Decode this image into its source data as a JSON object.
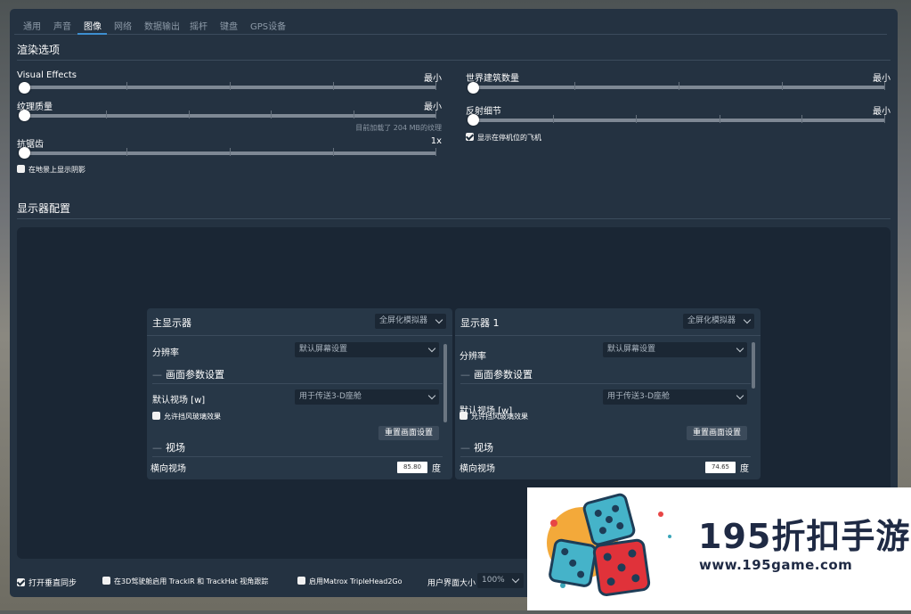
{
  "tabs": [
    "通用",
    "声音",
    "图像",
    "网络",
    "数据输出",
    "摇杆",
    "键盘",
    "GPS设备"
  ],
  "active_tab_index": 2,
  "render": {
    "title": "渲染选项",
    "visual_effects": {
      "label": "Visual Effects",
      "value": "最小"
    },
    "texture_quality": {
      "label": "纹理质量",
      "value": "最小",
      "hint": "目前加载了 204 MB的纹理"
    },
    "antialiasing": {
      "label": "抗锯齿",
      "value": "1x"
    },
    "ground_shadows": {
      "label": "在地景上显示阴影",
      "checked": false
    },
    "world_objects": {
      "label": "世界建筑数量",
      "value": "最小"
    },
    "reflection_detail": {
      "label": "反射细节",
      "value": "最小"
    },
    "parked_aircraft": {
      "label": "显示在停机位的飞机",
      "checked": true
    }
  },
  "display": {
    "title": "显示器配置",
    "monitors": [
      {
        "title": "主显示器",
        "mode": "全屏化模拟器",
        "resolution_label": "分辨率",
        "resolution_value": "默认屏幕设置",
        "param_section": "画面参数设置",
        "fov_default_label": "默认视场 [w]",
        "fov_default_value": "用于传送3-D座舱",
        "windshield_label": "允许挡风玻璃效果",
        "windshield_checked": false,
        "reset_label": "重置画面设置",
        "fov_section": "视场",
        "hfov_label": "横向视场",
        "hfov_value": "85.80",
        "hfov_unit": "度"
      },
      {
        "title": "显示器 1",
        "mode": "全屏化模拟器",
        "resolution_label": "分辨率",
        "resolution_value": "默认屏幕设置",
        "param_section": "画面参数设置",
        "fov_default_label": "默认视场 [w]",
        "fov_default_value": "用于传送3-D座舱",
        "windshield_label": "允许挡风玻璃效果",
        "windshield_checked": false,
        "reset_label": "重置画面设置",
        "fov_section": "视场",
        "hfov_label": "横向视场",
        "hfov_value": "74.65",
        "hfov_unit": "度"
      }
    ]
  },
  "bottom": {
    "vsync": {
      "label": "打开垂直同步",
      "checked": true
    },
    "trackir": {
      "label": "在3D驾驶舱启用 TrackIR 和 TrackHat 视角跟踪",
      "checked": false
    },
    "matrox": {
      "label": "启用Matrox TripleHead2Go",
      "checked": false
    },
    "ui_size_label": "用户界面大小",
    "ui_size_value": "100%"
  },
  "watermark": {
    "brand": "195折扣手游",
    "url": "www.195game.com"
  },
  "colors": {
    "panel": "#243241",
    "accent": "#3d8fd0",
    "display_area": "#1a2634"
  }
}
